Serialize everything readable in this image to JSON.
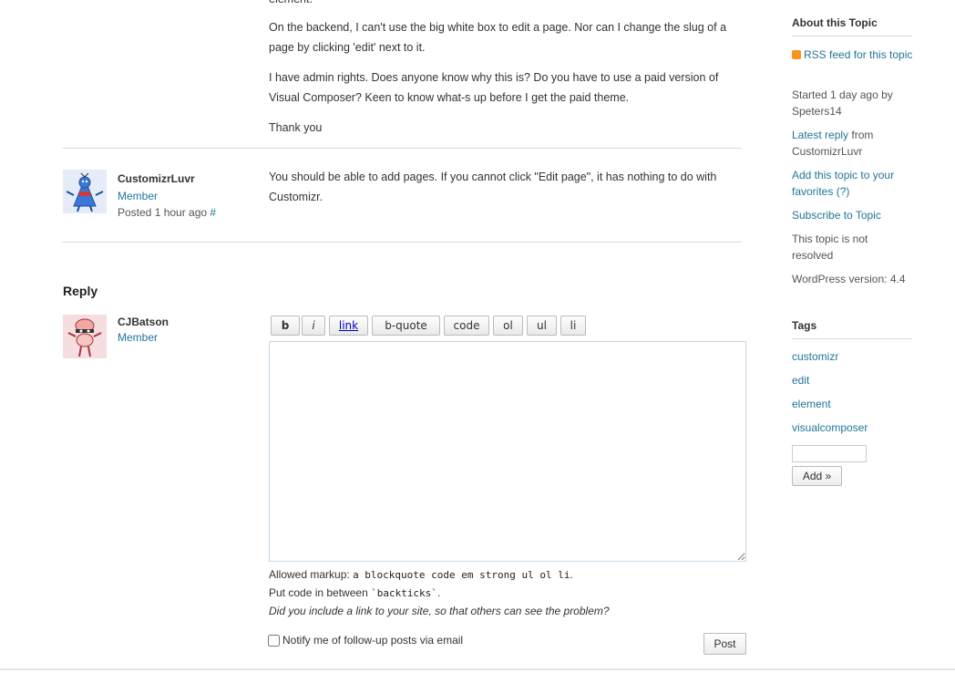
{
  "topic": {
    "cut_line": "element.",
    "paragraphs": [
      "On the backend, I can't use the big white box to edit a page. Nor can I change the slug of a page by clicking 'edit' next to it.",
      "I have admin rights. Does anyone know why this is? Do you have to use a paid version of Visual Composer? Keen to know what-s up before I get the paid theme.",
      "Thank you"
    ]
  },
  "reply_post": {
    "author": "CustomizrLuvr",
    "role": "Member",
    "posted": "Posted 1 hour ago",
    "permalink": "#",
    "text": "You should be able to add pages. If you cannot click \"Edit page\", it has nothing to do with Customizr."
  },
  "reply_form": {
    "heading": "Reply",
    "author": "CJBatson",
    "role": "Member",
    "toolbar": [
      "b",
      "i",
      "link",
      "b-quote",
      "code",
      "ol",
      "ul",
      "li"
    ],
    "textarea_value": "",
    "allowed_label": "Allowed markup:",
    "allowed_tags": "a blockquote code em strong ul ol li",
    "allowed_end": ".",
    "code_hint_pre": "Put code in between ",
    "code_hint_code": "`backticks`",
    "code_hint_end": ".",
    "link_hint": "Did you include a link to your site, so that others can see the problem?",
    "notify_label": "Notify me of follow-up posts via email",
    "notify_checked": false,
    "post_button": "Post"
  },
  "sidebar": {
    "about_heading": "About this Topic",
    "rss_link": "RSS feed for this topic",
    "started_pre": "Started ",
    "started_ago": "1 day ago",
    "started_by": " by ",
    "started_author": "Speters14",
    "latest_reply_link": "Latest reply",
    "latest_from": " from ",
    "latest_author": "CustomizrLuvr",
    "favorites_link": "Add this topic to your favorites",
    "favorites_help": "(?)",
    "subscribe_link": "Subscribe to Topic",
    "resolved_status": "This topic is not resolved",
    "wp_version": "WordPress version: 4.4",
    "tags_heading": "Tags",
    "tags": [
      "customizr",
      "edit",
      "element",
      "visualcomposer"
    ],
    "tag_input_value": "",
    "add_button": "Add »"
  },
  "colors": {
    "link": "#21759b",
    "text": "#333333",
    "rule": "#dddddd",
    "rss": "#f7931e"
  }
}
